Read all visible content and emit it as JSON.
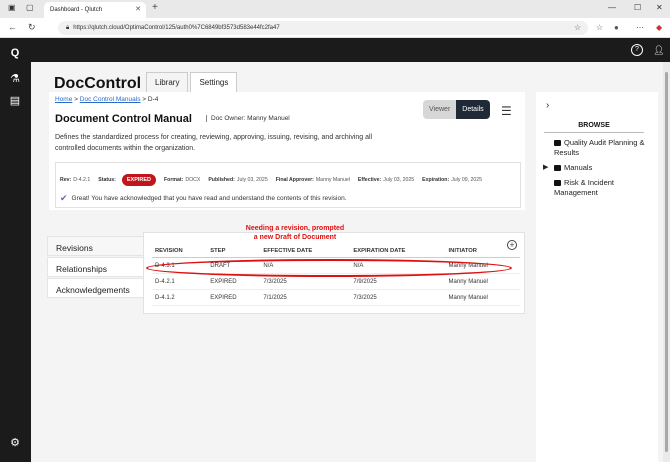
{
  "browser": {
    "tab_title": "Dashboard - Qlutch",
    "url": "https://qlutch.cloud/OptimaControl/125/auth0%7C6849bf3573d583e44fc2fa47"
  },
  "app": {
    "title": "DocControl",
    "tabs": [
      {
        "label": "Library"
      },
      {
        "label": "Settings"
      }
    ]
  },
  "breadcrumb": {
    "home": "Home",
    "manuals": "Doc Control Manuals",
    "sep": ">",
    "current": "D-4"
  },
  "document": {
    "title": "Document Control Manual",
    "owner": "Doc Owner: Manny Manuel",
    "description": "Defines the standardized process for creating, reviewing, approving, issuing, revising, and archiving all controlled documents within the organization.",
    "viewer_label": "Viewer",
    "details_label": "Details"
  },
  "meta": {
    "rev_label": "Rev:",
    "rev_value": "D-4.2.1",
    "status_label": "Status:",
    "status_value": "EXPIRED",
    "format_label": "Format:",
    "format_value": "DOCX",
    "published_label": "Published:",
    "published_value": "July 03, 2025",
    "final_approver_label": "Final Approver:",
    "final_approver_value": "Manny Manuel",
    "effective_label": "Effective:",
    "effective_value": "July 03, 2025",
    "expiration_label": "Expiration:",
    "expiration_value": "July 09, 2025",
    "acknowledgement": "Great! You have acknowledged that you have read and understand the contents of this revision."
  },
  "left_tabs": [
    {
      "label": "Revisions"
    },
    {
      "label": "Relationships"
    },
    {
      "label": "Acknowledgements"
    }
  ],
  "revisions": {
    "headers": [
      "REVISION",
      "STEP",
      "EFFECTIVE DATE",
      "EXPIRATION DATE",
      "INITIATOR"
    ],
    "rows": [
      [
        "D-4.3.1",
        "DRAFT",
        "N/A",
        "N/A",
        "Manny Manuel"
      ],
      [
        "D-4.2.1",
        "EXPIRED",
        "7/3/2025",
        "7/9/2025",
        "Manny Manuel"
      ],
      [
        "D-4.1.2",
        "EXPIRED",
        "7/1/2025",
        "7/3/2025",
        "Manny Manuel"
      ]
    ]
  },
  "annotation": {
    "line1": "Needing a revision, prompted",
    "line2": "a new Draft of Document"
  },
  "browse": {
    "title": "BROWSE",
    "folders": [
      {
        "label": "Quality Audit Planning & Results"
      },
      {
        "label": "Manuals"
      },
      {
        "label": "Risk & Incident Management"
      }
    ]
  },
  "colors": {
    "status_expired": "#c0151d",
    "annotation": "#dd1111",
    "topbar": "#1b1b1b"
  }
}
